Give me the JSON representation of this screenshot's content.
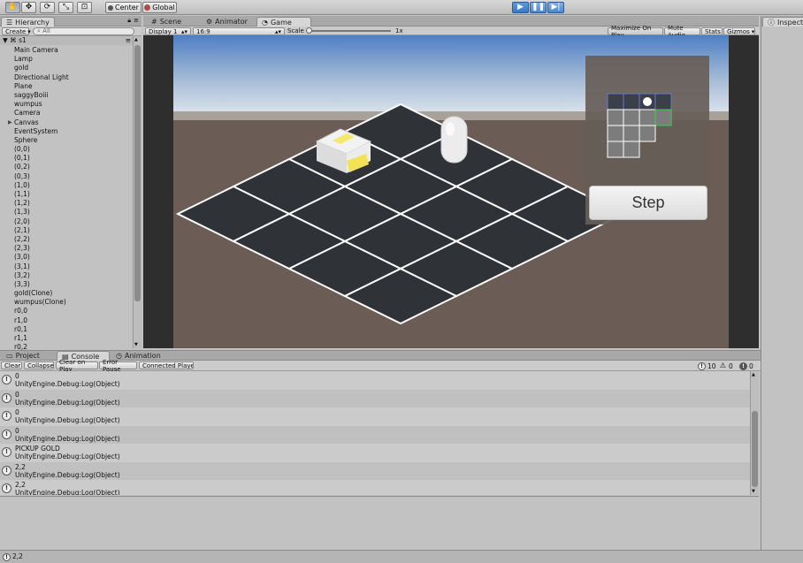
{
  "toolbar": {
    "tools": [
      "hand-icon",
      "move-icon",
      "rotate-icon",
      "scale-icon",
      "rect-icon"
    ],
    "pivot_label": "Center",
    "space_label": "Global",
    "play": "play-icon",
    "pause": "pause-icon",
    "step": "step-icon"
  },
  "hierarchy": {
    "tab": "Hierarchy",
    "create_label": "Create",
    "search_placeholder": "All",
    "scene_name": "s1",
    "items": [
      {
        "label": "Main Camera"
      },
      {
        "label": "Lamp"
      },
      {
        "label": "gold"
      },
      {
        "label": "Directional Light"
      },
      {
        "label": "Plane"
      },
      {
        "label": "saggyBoiii"
      },
      {
        "label": "wumpus"
      },
      {
        "label": "Camera"
      },
      {
        "label": "Canvas",
        "expandable": true
      },
      {
        "label": "EventSystem"
      },
      {
        "label": "Sphere"
      },
      {
        "label": "(0,0)"
      },
      {
        "label": "(0,1)"
      },
      {
        "label": "(0,2)"
      },
      {
        "label": "(0,3)"
      },
      {
        "label": "(1,0)"
      },
      {
        "label": "(1,1)"
      },
      {
        "label": "(1,2)"
      },
      {
        "label": "(1,3)"
      },
      {
        "label": "(2,0)"
      },
      {
        "label": "(2,1)"
      },
      {
        "label": "(2,2)"
      },
      {
        "label": "(2,3)"
      },
      {
        "label": "(3,0)"
      },
      {
        "label": "(3,1)"
      },
      {
        "label": "(3,2)"
      },
      {
        "label": "(3,3)"
      },
      {
        "label": "gold(Clone)"
      },
      {
        "label": "wumpus(Clone)"
      },
      {
        "label": "r0,0"
      },
      {
        "label": "r1,0"
      },
      {
        "label": "r0,1"
      },
      {
        "label": "r1,1"
      },
      {
        "label": "r0,2"
      }
    ]
  },
  "center_tabs": {
    "scene": "Scene",
    "animator": "Animator",
    "game": "Game"
  },
  "game_bar": {
    "display": "Display 1",
    "aspect": "16:9",
    "scale_label": "Scale",
    "scale_value": "1x",
    "maximize": "Maximize On Play",
    "mute": "Mute Audio",
    "stats": "Stats",
    "gizmos": "Gizmos"
  },
  "game": {
    "step_button": "Step",
    "minimap": {
      "rows": 4,
      "cols": 4,
      "cells": [
        [
          "dark",
          "dark",
          "player",
          "dark"
        ],
        [
          "light",
          "light",
          "light",
          "green"
        ],
        [
          "light",
          "light",
          "light",
          "none"
        ],
        [
          "light",
          "light",
          "none",
          "none"
        ]
      ]
    }
  },
  "inspector": {
    "tab": "Inspector"
  },
  "console_tabs": {
    "project": "Project",
    "console": "Console",
    "animation": "Animation"
  },
  "console_bar": {
    "clear": "Clear",
    "collapse": "Collapse",
    "clear_on_play": "Clear on Play",
    "error_pause": "Error Pause",
    "connected": "Connected Player",
    "log_count": "10",
    "warn_count": "0",
    "error_count": "0"
  },
  "console": {
    "entries": [
      {
        "line1": "0",
        "line2": "UnityEngine.Debug:Log(Object)"
      },
      {
        "line1": "0",
        "line2": "UnityEngine.Debug:Log(Object)"
      },
      {
        "line1": "0",
        "line2": "UnityEngine.Debug:Log(Object)"
      },
      {
        "line1": "0",
        "line2": "UnityEngine.Debug:Log(Object)"
      },
      {
        "line1": "PICKUP GOLD",
        "line2": "UnityEngine.Debug:Log(Object)"
      },
      {
        "line1": "2,2",
        "line2": "UnityEngine.Debug:Log(Object)"
      },
      {
        "line1": "2,2",
        "line2": "UnityEngine.Debug:Log(Object)"
      }
    ]
  },
  "status": {
    "text": "2,2"
  },
  "colors": {
    "play_blue": "#3a78c8",
    "tile": "#2f3237",
    "ground": "#6b5d55",
    "sky_top": "#4f7fc4"
  }
}
